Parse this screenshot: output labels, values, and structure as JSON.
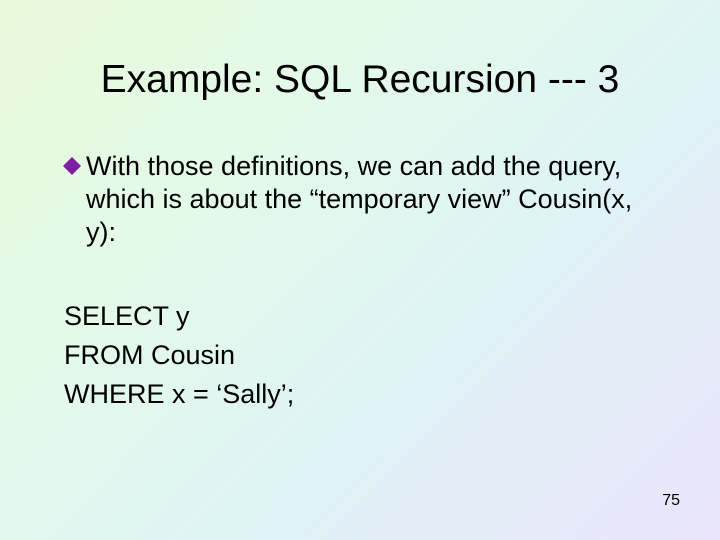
{
  "title": "Example: SQL Recursion --- 3",
  "bullet": {
    "text": "With those definitions, we can add the query, which is about the “temporary view” Cousin(x, y):"
  },
  "code": {
    "line1": "SELECT y",
    "line2": "FROM Cousin",
    "line3": "WHERE x = ‘Sally’;"
  },
  "page_number": "75",
  "colors": {
    "bullet_fill": "#7d1fa3"
  }
}
